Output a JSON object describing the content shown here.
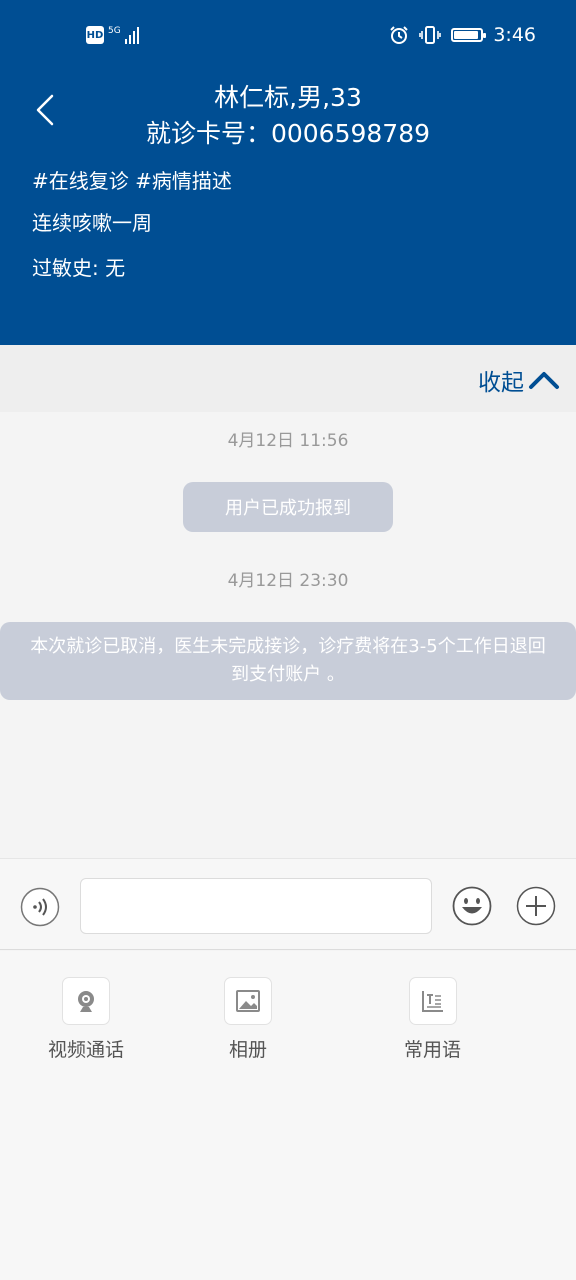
{
  "status_bar": {
    "hd": "HD",
    "network": "5G",
    "time": "3:46",
    "battery_level": 0.85
  },
  "header": {
    "patient_line": "林仁标,男,33",
    "card_line": "就诊卡号：0006598789",
    "tags": "#在线复诊 #病情描述",
    "complaint": "连续咳嗽一周",
    "allergy": "过敏史: 无"
  },
  "collapse": {
    "label": "收起"
  },
  "chat": {
    "timestamp1": "4月12日 11:56",
    "checkin_notice": "用户已成功报到",
    "timestamp2": "4月12日 23:30",
    "cancel_notice": "本次就诊已取消，医生未完成接诊，诊疗费将在3-5个工作日退回到支付账户 。"
  },
  "input": {
    "value": "",
    "placeholder": ""
  },
  "tools": [
    {
      "label": "视频通话",
      "icon": "video-camera-icon"
    },
    {
      "label": "相册",
      "icon": "image-icon"
    },
    {
      "label": "常用语",
      "icon": "phrases-icon"
    }
  ],
  "colors": {
    "header_bg": "#004e93",
    "accent": "#004e93",
    "pill_bg": "#c8cdd9"
  }
}
